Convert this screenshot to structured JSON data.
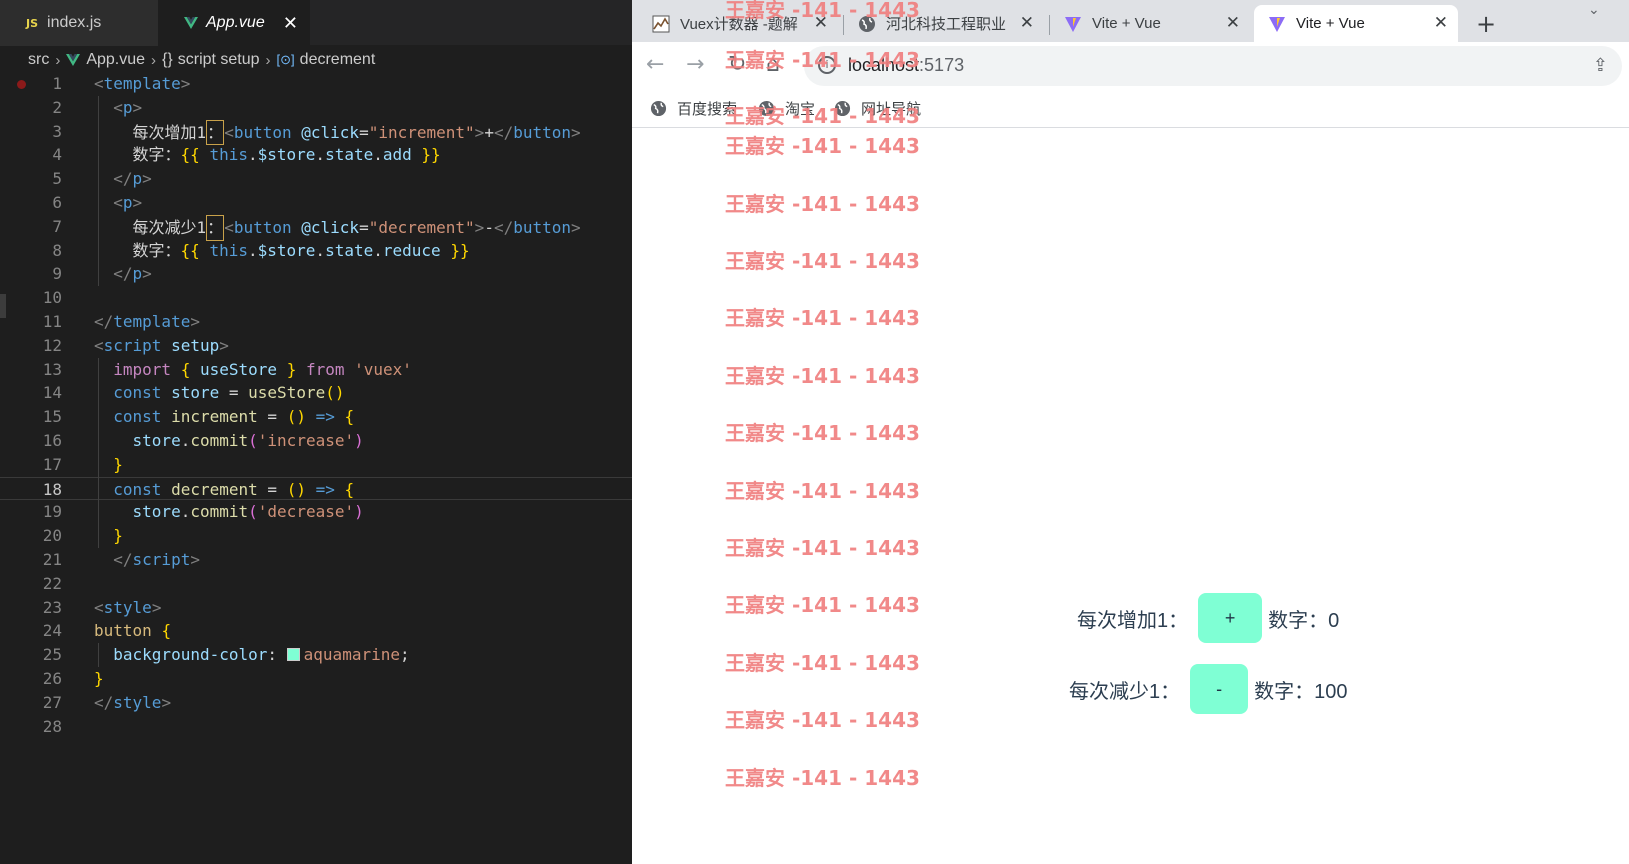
{
  "editor": {
    "tabs": [
      {
        "icon": "JS",
        "label": "index.js"
      },
      {
        "icon": "vue-icon",
        "label": "App.vue",
        "close": "✕"
      }
    ],
    "breadcrumb": {
      "root": "src",
      "file": "App.vue",
      "braces": "{}",
      "section": "script setup",
      "symbol": "decrement"
    },
    "current_line": 18,
    "lines": [
      {
        "n": "1",
        "tokens": [
          [
            "t-punc",
            "<"
          ],
          [
            "t-tag",
            "template"
          ],
          [
            "t-punc",
            ">"
          ]
        ]
      },
      {
        "n": "2",
        "tokens": [
          [
            "t-text",
            "  "
          ],
          [
            "t-punc",
            "<"
          ],
          [
            "t-tag",
            "p"
          ],
          [
            "t-punc",
            ">"
          ]
        ]
      },
      {
        "n": "3",
        "tokens": [
          [
            "t-text",
            "    每次增加1"
          ],
          [
            "t-hint",
            "："
          ],
          [
            "t-punc",
            "<"
          ],
          [
            "t-tag",
            "button"
          ],
          [
            "t-text",
            " "
          ],
          [
            "t-attr",
            "@click"
          ],
          [
            "t-text",
            "="
          ],
          [
            "t-str",
            "\"increment\""
          ],
          [
            "t-punc",
            ">"
          ],
          [
            "t-text",
            "+"
          ],
          [
            "t-punc",
            "</"
          ],
          [
            "t-tag",
            "button"
          ],
          [
            "t-punc",
            ">"
          ]
        ]
      },
      {
        "n": "4",
        "tokens": [
          [
            "t-text",
            "    数字："
          ],
          [
            "t-br1",
            "{{"
          ],
          [
            "t-text",
            " "
          ],
          [
            "t-this",
            "this"
          ],
          [
            "t-text",
            "."
          ],
          [
            "t-var",
            "$store"
          ],
          [
            "t-text",
            "."
          ],
          [
            "t-var",
            "state"
          ],
          [
            "t-text",
            "."
          ],
          [
            "t-var",
            "add"
          ],
          [
            "t-text",
            " "
          ],
          [
            "t-br1",
            "}}"
          ]
        ]
      },
      {
        "n": "5",
        "tokens": [
          [
            "t-text",
            "  "
          ],
          [
            "t-punc",
            "</"
          ],
          [
            "t-tag",
            "p"
          ],
          [
            "t-punc",
            ">"
          ]
        ]
      },
      {
        "n": "6",
        "tokens": [
          [
            "t-text",
            "  "
          ],
          [
            "t-punc",
            "<"
          ],
          [
            "t-tag",
            "p"
          ],
          [
            "t-punc",
            ">"
          ]
        ]
      },
      {
        "n": "7",
        "tokens": [
          [
            "t-text",
            "    每次减少1"
          ],
          [
            "t-hint",
            "："
          ],
          [
            "t-punc",
            "<"
          ],
          [
            "t-tag",
            "button"
          ],
          [
            "t-text",
            " "
          ],
          [
            "t-attr",
            "@click"
          ],
          [
            "t-text",
            "="
          ],
          [
            "t-str",
            "\"decrement\""
          ],
          [
            "t-punc",
            ">"
          ],
          [
            "t-text",
            "-"
          ],
          [
            "t-punc",
            "</"
          ],
          [
            "t-tag",
            "button"
          ],
          [
            "t-punc",
            ">"
          ]
        ]
      },
      {
        "n": "8",
        "tokens": [
          [
            "t-text",
            "    数字："
          ],
          [
            "t-br1",
            "{{"
          ],
          [
            "t-text",
            " "
          ],
          [
            "t-this",
            "this"
          ],
          [
            "t-text",
            "."
          ],
          [
            "t-var",
            "$store"
          ],
          [
            "t-text",
            "."
          ],
          [
            "t-var",
            "state"
          ],
          [
            "t-text",
            "."
          ],
          [
            "t-var",
            "reduce"
          ],
          [
            "t-text",
            " "
          ],
          [
            "t-br1",
            "}}"
          ]
        ]
      },
      {
        "n": "9",
        "tokens": [
          [
            "t-text",
            "  "
          ],
          [
            "t-punc",
            "</"
          ],
          [
            "t-tag",
            "p"
          ],
          [
            "t-punc",
            ">"
          ]
        ]
      },
      {
        "n": "10",
        "tokens": []
      },
      {
        "n": "11",
        "tokens": [
          [
            "t-punc",
            "</"
          ],
          [
            "t-tag",
            "template"
          ],
          [
            "t-punc",
            ">"
          ]
        ]
      },
      {
        "n": "12",
        "tokens": [
          [
            "t-punc",
            "<"
          ],
          [
            "t-tag",
            "script"
          ],
          [
            "t-text",
            " "
          ],
          [
            "t-attr",
            "setup"
          ],
          [
            "t-punc",
            ">"
          ]
        ]
      },
      {
        "n": "13",
        "tokens": [
          [
            "t-text",
            "  "
          ],
          [
            "t-imp",
            "import"
          ],
          [
            "t-text",
            " "
          ],
          [
            "t-br1",
            "{"
          ],
          [
            "t-text",
            " "
          ],
          [
            "t-var",
            "useStore"
          ],
          [
            "t-text",
            " "
          ],
          [
            "t-br1",
            "}"
          ],
          [
            "t-text",
            " "
          ],
          [
            "t-imp",
            "from"
          ],
          [
            "t-text",
            " "
          ],
          [
            "t-str2",
            "'vuex'"
          ]
        ]
      },
      {
        "n": "14",
        "tokens": [
          [
            "t-text",
            "  "
          ],
          [
            "t-kw",
            "const"
          ],
          [
            "t-text",
            " "
          ],
          [
            "t-var",
            "store"
          ],
          [
            "t-text",
            " = "
          ],
          [
            "t-fn",
            "useStore"
          ],
          [
            "t-br1",
            "()"
          ]
        ]
      },
      {
        "n": "15",
        "tokens": [
          [
            "t-text",
            "  "
          ],
          [
            "t-kw",
            "const"
          ],
          [
            "t-text",
            " "
          ],
          [
            "t-fn",
            "increment"
          ],
          [
            "t-text",
            " = "
          ],
          [
            "t-br1",
            "()"
          ],
          [
            "t-text",
            " "
          ],
          [
            "t-kw",
            "=>"
          ],
          [
            "t-text",
            " "
          ],
          [
            "t-br1",
            "{"
          ]
        ]
      },
      {
        "n": "16",
        "tokens": [
          [
            "t-text",
            "    "
          ],
          [
            "t-var",
            "store"
          ],
          [
            "t-text",
            "."
          ],
          [
            "t-fn",
            "commit"
          ],
          [
            "t-br2",
            "("
          ],
          [
            "t-str2",
            "'increase'"
          ],
          [
            "t-br2",
            ")"
          ]
        ]
      },
      {
        "n": "17",
        "tokens": [
          [
            "t-text",
            "  "
          ],
          [
            "t-br1",
            "}"
          ]
        ]
      },
      {
        "n": "18",
        "tokens": [
          [
            "t-text",
            "  "
          ],
          [
            "t-kw",
            "const"
          ],
          [
            "t-text",
            " "
          ],
          [
            "t-fn",
            "decrement"
          ],
          [
            "t-text",
            " = "
          ],
          [
            "t-br1",
            "()"
          ],
          [
            "t-text",
            " "
          ],
          [
            "t-kw",
            "=>"
          ],
          [
            "t-text",
            " "
          ],
          [
            "t-br1",
            "{"
          ]
        ]
      },
      {
        "n": "19",
        "tokens": [
          [
            "t-text",
            "    "
          ],
          [
            "t-var",
            "store"
          ],
          [
            "t-text",
            "."
          ],
          [
            "t-fn",
            "commit"
          ],
          [
            "t-br2",
            "("
          ],
          [
            "t-str2",
            "'decrease'"
          ],
          [
            "t-br2",
            ")"
          ]
        ]
      },
      {
        "n": "20",
        "tokens": [
          [
            "t-text",
            "  "
          ],
          [
            "t-br1",
            "}"
          ]
        ]
      },
      {
        "n": "21",
        "tokens": [
          [
            "t-text",
            "  "
          ],
          [
            "t-punc",
            "</"
          ],
          [
            "t-tag",
            "script"
          ],
          [
            "t-punc",
            ">"
          ]
        ]
      },
      {
        "n": "22",
        "tokens": []
      },
      {
        "n": "23",
        "tokens": [
          [
            "t-punc",
            "<"
          ],
          [
            "t-tag",
            "style"
          ],
          [
            "t-punc",
            ">"
          ]
        ]
      },
      {
        "n": "24",
        "tokens": [
          [
            "t-sel",
            "button"
          ],
          [
            "t-text",
            " "
          ],
          [
            "t-br1",
            "{"
          ]
        ]
      },
      {
        "n": "25",
        "tokens": [
          [
            "t-text",
            "  "
          ],
          [
            "t-prop",
            "background-color"
          ],
          [
            "t-text",
            ": "
          ],
          [
            "swatch",
            ""
          ],
          [
            "t-str",
            "aquamarine"
          ],
          [
            "t-text",
            ";"
          ]
        ]
      },
      {
        "n": "26",
        "tokens": [
          [
            "t-br1",
            "}"
          ]
        ]
      },
      {
        "n": "27",
        "tokens": [
          [
            "t-punc",
            "</"
          ],
          [
            "t-tag",
            "style"
          ],
          [
            "t-punc",
            ">"
          ]
        ]
      },
      {
        "n": "28",
        "tokens": []
      }
    ],
    "swatch_color": "#7fffd4"
  },
  "browser": {
    "tabs": [
      {
        "icon": "juejin-favicon-icon",
        "title": "Vuex计数器 -题解",
        "close": "✕"
      },
      {
        "icon": "globe-icon",
        "title": "河北科技工程职业技",
        "close": "✕"
      },
      {
        "icon": "vite-icon",
        "title": "Vite + Vue",
        "close": "✕"
      },
      {
        "icon": "vite-icon",
        "title": "Vite + Vue",
        "close": "✕",
        "active": true
      }
    ],
    "new_tab": "+",
    "tab_search": "⌄",
    "toolbar": {
      "back": "←",
      "forward": "→",
      "reload": "↻",
      "home": "⌂",
      "info": "i",
      "url_host": "localhost",
      "url_port": ":5173",
      "share": "⇪"
    },
    "bookmarks": [
      "百度搜索",
      "淘宝",
      "网址导航"
    ],
    "watermark": "王嘉安 -141 - 1443",
    "app": {
      "inc_label": "每次增加1：",
      "inc_button": "+",
      "inc_value_label": "数字：0",
      "dec_label": "每次减少1：",
      "dec_button": "-",
      "dec_value_label": "数字：100",
      "button_color": "#7fffd4"
    }
  }
}
